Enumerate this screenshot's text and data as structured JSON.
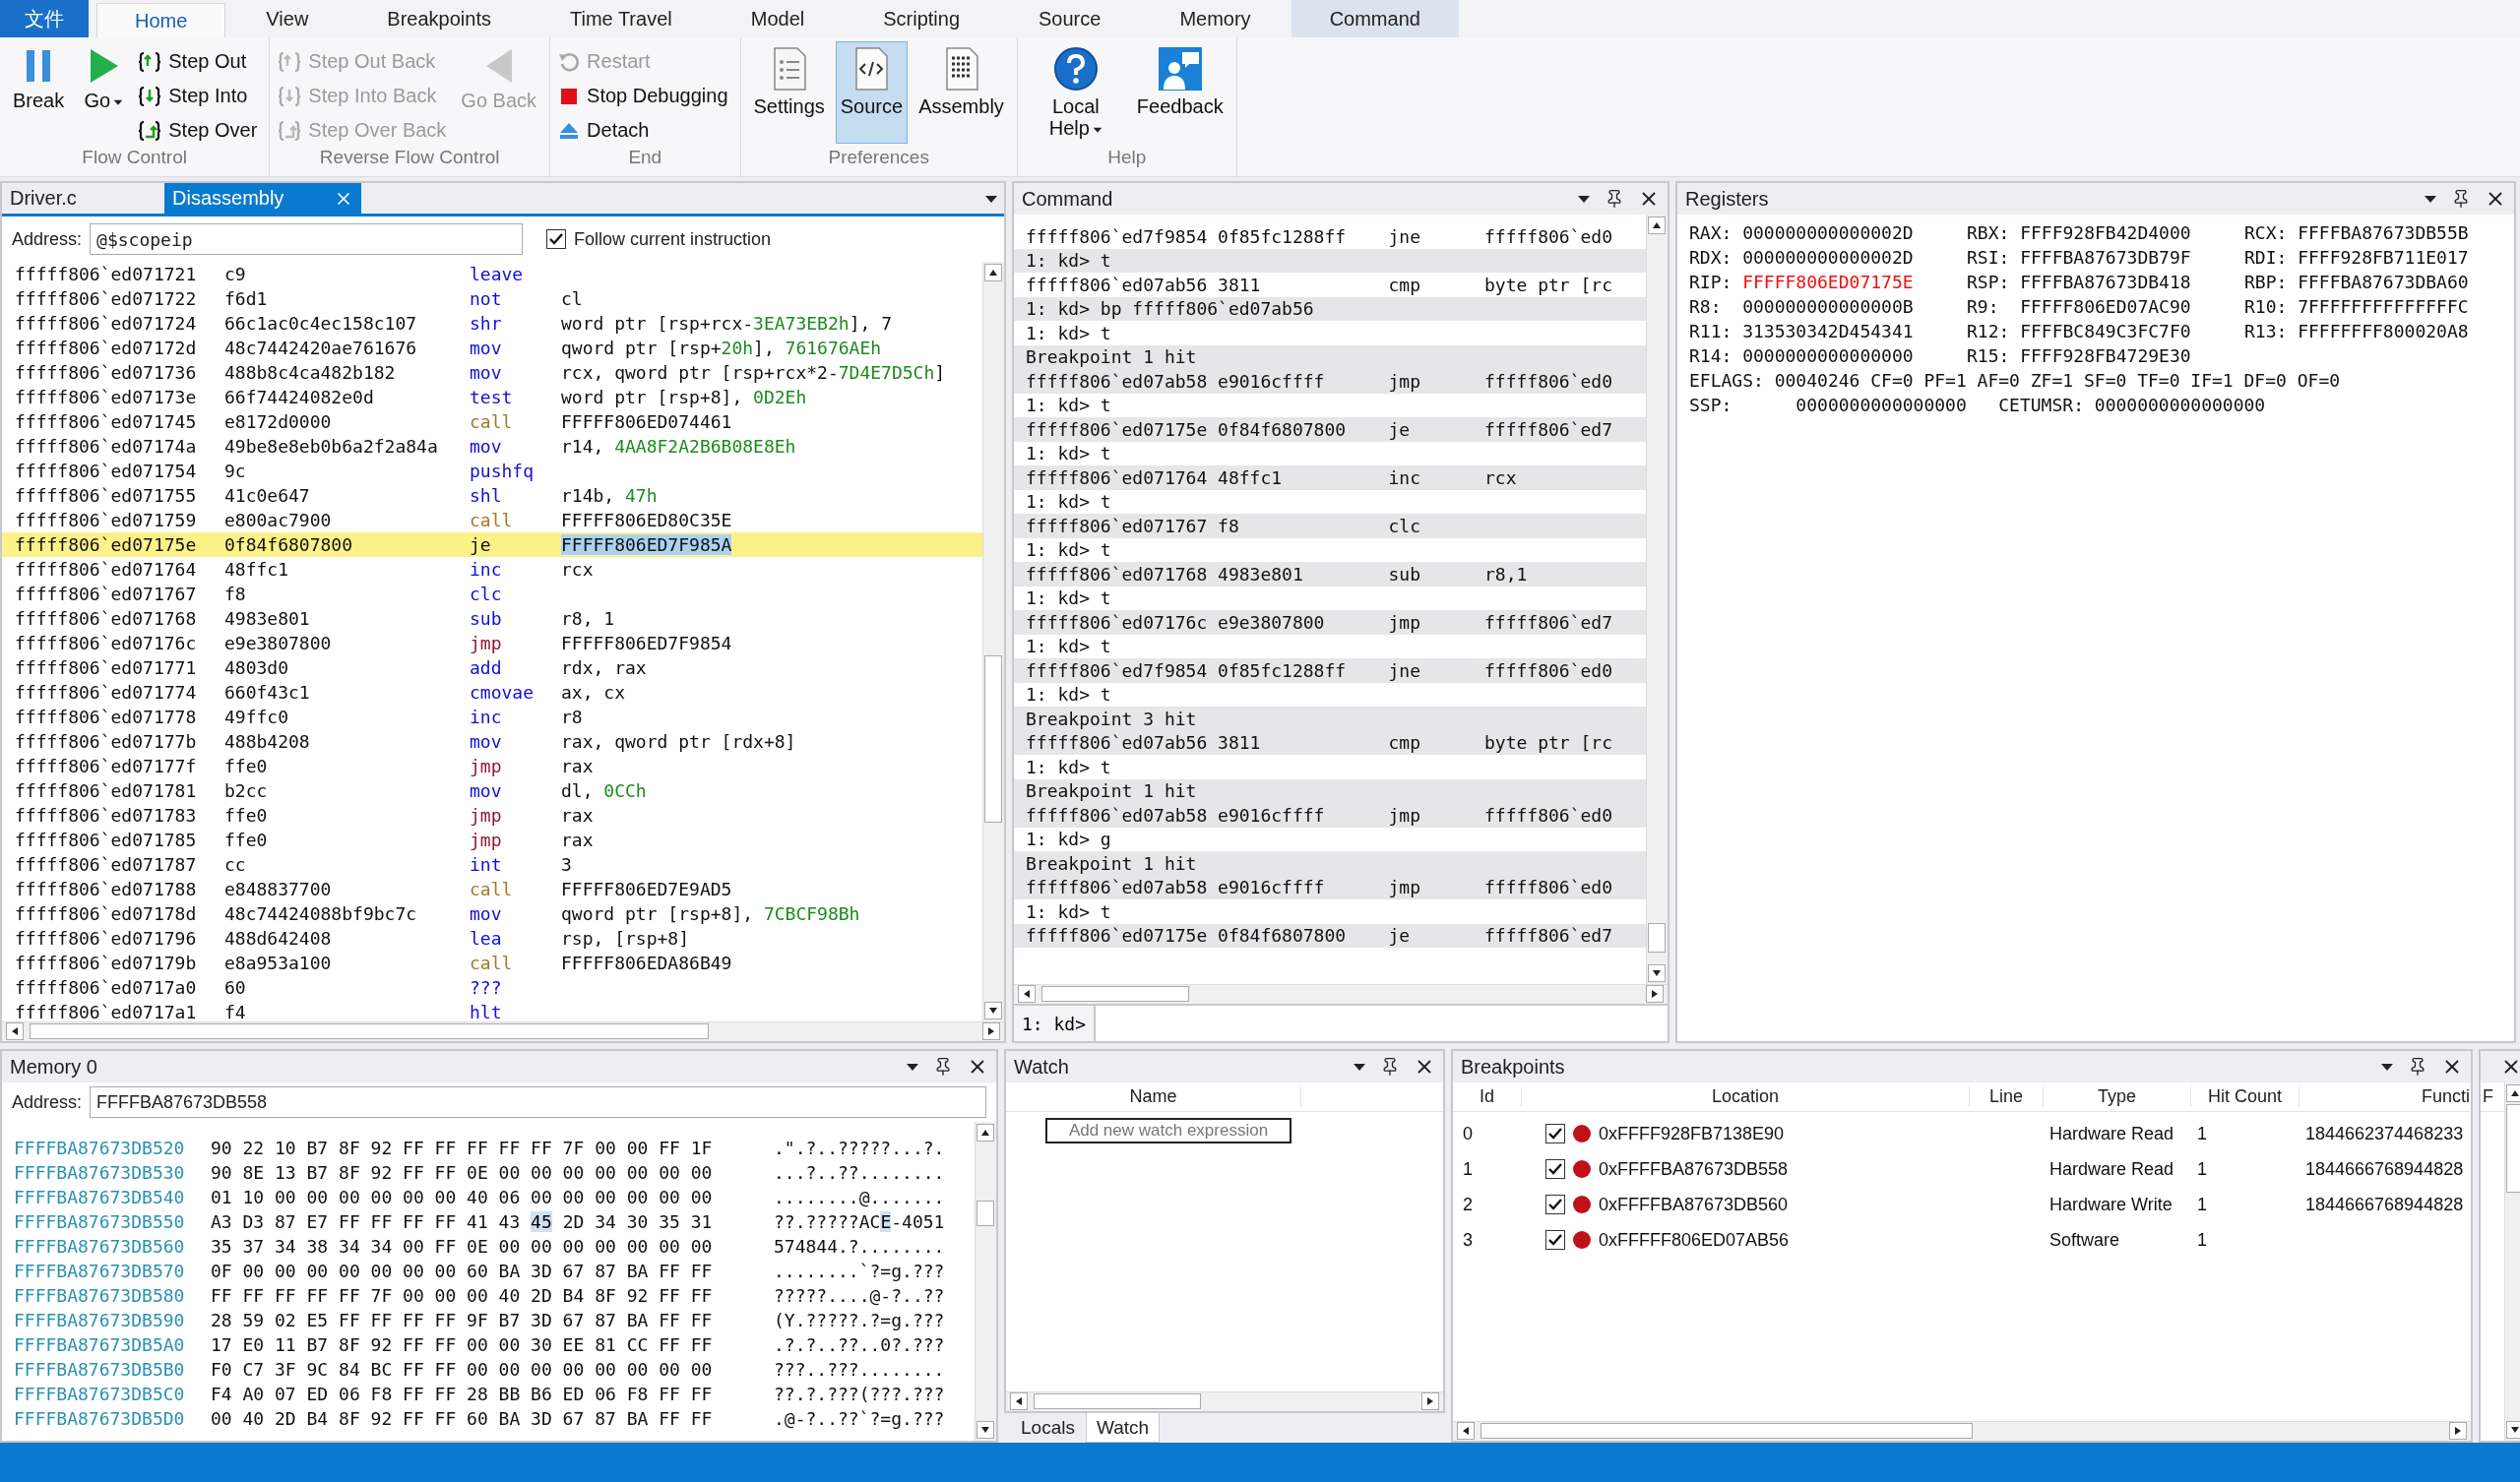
{
  "ribbon": {
    "tabs": [
      {
        "label": "文件",
        "kind": "file",
        "selected": false
      },
      {
        "label": "Home",
        "kind": "tab",
        "selected": true,
        "contextual": false
      },
      {
        "label": "View",
        "kind": "tab",
        "selected": false,
        "contextual": false
      },
      {
        "label": "Breakpoints",
        "kind": "tab",
        "selected": false,
        "contextual": false
      },
      {
        "label": "Time Travel",
        "kind": "tab",
        "selected": false,
        "contextual": false
      },
      {
        "label": "Model",
        "kind": "tab",
        "selected": false,
        "contextual": false
      },
      {
        "label": "Scripting",
        "kind": "tab",
        "selected": false,
        "contextual": false
      },
      {
        "label": "Source",
        "kind": "tab",
        "selected": false,
        "contextual": false
      },
      {
        "label": "Memory",
        "kind": "tab",
        "selected": false,
        "contextual": false
      },
      {
        "label": "Command",
        "kind": "tab",
        "selected": false,
        "contextual": true
      }
    ],
    "groups": [
      {
        "label": "Flow Control",
        "items": [
          {
            "kind": "large",
            "label": "Break",
            "disabled": false,
            "selected": false,
            "dropdown": false
          },
          {
            "kind": "large",
            "label": "Go",
            "disabled": false,
            "selected": false,
            "dropdown": true
          },
          {
            "kind": "small",
            "label": "Step Out",
            "disabled": false
          },
          {
            "kind": "small",
            "label": "Step Into",
            "disabled": false
          },
          {
            "kind": "small",
            "label": "Step Over",
            "disabled": false
          }
        ]
      },
      {
        "label": "Reverse Flow Control",
        "items": [
          {
            "kind": "small",
            "label": "Step Out Back",
            "disabled": true
          },
          {
            "kind": "small",
            "label": "Step Into Back",
            "disabled": true
          },
          {
            "kind": "small",
            "label": "Step Over Back",
            "disabled": true
          },
          {
            "kind": "large",
            "label": "Go Back",
            "disabled": true,
            "selected": false,
            "dropdown": false
          }
        ]
      },
      {
        "label": "End",
        "items": [
          {
            "kind": "small",
            "label": "Restart",
            "disabled": true
          },
          {
            "kind": "small",
            "label": "Stop Debugging",
            "disabled": false
          },
          {
            "kind": "small",
            "label": "Detach",
            "disabled": false
          }
        ]
      },
      {
        "label": "Preferences",
        "items": [
          {
            "kind": "large",
            "label": "Settings",
            "disabled": false,
            "selected": false,
            "dropdown": false
          },
          {
            "kind": "large",
            "label": "Source",
            "disabled": false,
            "selected": true,
            "dropdown": false
          },
          {
            "kind": "large",
            "label": "Assembly",
            "disabled": false,
            "selected": false,
            "dropdown": false
          }
        ]
      },
      {
        "label": "Help",
        "items": [
          {
            "kind": "large",
            "label": "Local Help",
            "disabled": false,
            "selected": false,
            "dropdown": true
          },
          {
            "kind": "large",
            "label": "Feedback",
            "disabled": false,
            "selected": false,
            "dropdown": false
          }
        ]
      }
    ]
  },
  "disassembly": {
    "tabs": [
      {
        "label": "Driver.c",
        "selected": false
      },
      {
        "label": "Disassembly",
        "selected": true
      }
    ],
    "address_label": "Address:",
    "address": "@$scopeip",
    "follow": {
      "label": "Follow current instruction",
      "checked": true
    },
    "rows": [
      {
        "address": "fffff806`ed071721",
        "bytes": "c9",
        "mnemonic": "leave",
        "color": "#1010d8",
        "current": false,
        "operands": []
      },
      {
        "address": "fffff806`ed071722",
        "bytes": "f6d1",
        "mnemonic": "not",
        "color": "#1010d8",
        "current": false,
        "operands": [
          {
            "text": "cl",
            "color": "#111111",
            "selected": false
          }
        ]
      },
      {
        "address": "fffff806`ed071724",
        "bytes": "66c1ac0c4ec158c107",
        "mnemonic": "shr",
        "color": "#1010d8",
        "current": false,
        "operands": [
          {
            "text": "word ptr [rsp+rcx-",
            "color": "#111111",
            "selected": false
          },
          {
            "text": "3EA73EB2h",
            "color": "#1c8a1c",
            "selected": false
          },
          {
            "text": "], 7",
            "color": "#111111",
            "selected": false
          }
        ]
      },
      {
        "address": "fffff806`ed07172d",
        "bytes": "48c7442420ae761676",
        "mnemonic": "mov",
        "color": "#1010d8",
        "current": false,
        "operands": [
          {
            "text": "qword ptr [rsp+",
            "color": "#111111",
            "selected": false
          },
          {
            "text": "20h",
            "color": "#1c8a1c",
            "selected": false
          },
          {
            "text": "], ",
            "color": "#111111",
            "selected": false
          },
          {
            "text": "761676AEh",
            "color": "#1c8a1c",
            "selected": false
          }
        ]
      },
      {
        "address": "fffff806`ed071736",
        "bytes": "488b8c4ca482b182",
        "mnemonic": "mov",
        "color": "#1010d8",
        "current": false,
        "operands": [
          {
            "text": "rcx, qword ptr [rsp+rcx*2-",
            "color": "#111111",
            "selected": false
          },
          {
            "text": "7D4E7D5Ch",
            "color": "#1c8a1c",
            "selected": false
          },
          {
            "text": "]",
            "color": "#111111",
            "selected": false
          }
        ]
      },
      {
        "address": "fffff806`ed07173e",
        "bytes": "66f74424082e0d",
        "mnemonic": "test",
        "color": "#1010d8",
        "current": false,
        "operands": [
          {
            "text": "word ptr [rsp+8], ",
            "color": "#111111",
            "selected": false
          },
          {
            "text": "0D2Eh",
            "color": "#1c8a1c",
            "selected": false
          }
        ]
      },
      {
        "address": "fffff806`ed071745",
        "bytes": "e8172d0000",
        "mnemonic": "call",
        "color": "#a07a28",
        "current": false,
        "operands": [
          {
            "text": "FFFFF806ED074461",
            "color": "#111111",
            "selected": false
          }
        ]
      },
      {
        "address": "fffff806`ed07174a",
        "bytes": "49be8e8eb0b6a2f2a84a",
        "mnemonic": "mov",
        "color": "#1010d8",
        "current": false,
        "operands": [
          {
            "text": "r14, ",
            "color": "#111111",
            "selected": false
          },
          {
            "text": "4AA8F2A2B6B08E8Eh",
            "color": "#1c8a1c",
            "selected": false
          }
        ]
      },
      {
        "address": "fffff806`ed071754",
        "bytes": "9c",
        "mnemonic": "pushfq",
        "color": "#1010d8",
        "current": false,
        "operands": []
      },
      {
        "address": "fffff806`ed071755",
        "bytes": "41c0e647",
        "mnemonic": "shl",
        "color": "#1010d8",
        "current": false,
        "operands": [
          {
            "text": "r14b, ",
            "color": "#111111",
            "selected": false
          },
          {
            "text": "47h",
            "color": "#1c8a1c",
            "selected": false
          }
        ]
      },
      {
        "address": "fffff806`ed071759",
        "bytes": "e800ac7900",
        "mnemonic": "call",
        "color": "#a07a28",
        "current": false,
        "operands": [
          {
            "text": "FFFFF806ED80C35E",
            "color": "#111111",
            "selected": false
          }
        ]
      },
      {
        "address": "fffff806`ed07175e",
        "bytes": "0f84f6807800",
        "mnemonic": "je",
        "color": "#111111",
        "current": true,
        "operands": [
          {
            "text": "FFFFF806ED7F985A",
            "color": "#111111",
            "selected": true
          }
        ]
      },
      {
        "address": "fffff806`ed071764",
        "bytes": "48ffc1",
        "mnemonic": "inc",
        "color": "#1010d8",
        "current": false,
        "operands": [
          {
            "text": "rcx",
            "color": "#111111",
            "selected": false
          }
        ]
      },
      {
        "address": "fffff806`ed071767",
        "bytes": "f8",
        "mnemonic": "clc",
        "color": "#1010d8",
        "current": false,
        "operands": []
      },
      {
        "address": "fffff806`ed071768",
        "bytes": "4983e801",
        "mnemonic": "sub",
        "color": "#1010d8",
        "current": false,
        "operands": [
          {
            "text": "r8, 1",
            "color": "#111111",
            "selected": false
          }
        ]
      },
      {
        "address": "fffff806`ed07176c",
        "bytes": "e9e3807800",
        "mnemonic": "jmp",
        "color": "#8c1838",
        "current": false,
        "operands": [
          {
            "text": "FFFFF806ED7F9854",
            "color": "#111111",
            "selected": false
          }
        ]
      },
      {
        "address": "fffff806`ed071771",
        "bytes": "4803d0",
        "mnemonic": "add",
        "color": "#1010d8",
        "current": false,
        "operands": [
          {
            "text": "rdx, rax",
            "color": "#111111",
            "selected": false
          }
        ]
      },
      {
        "address": "fffff806`ed071774",
        "bytes": "660f43c1",
        "mnemonic": "cmovae",
        "color": "#1010d8",
        "current": false,
        "operands": [
          {
            "text": "ax, cx",
            "color": "#111111",
            "selected": false
          }
        ]
      },
      {
        "address": "fffff806`ed071778",
        "bytes": "49ffc0",
        "mnemonic": "inc",
        "color": "#1010d8",
        "current": false,
        "operands": [
          {
            "text": "r8",
            "color": "#111111",
            "selected": false
          }
        ]
      },
      {
        "address": "fffff806`ed07177b",
        "bytes": "488b4208",
        "mnemonic": "mov",
        "color": "#1010d8",
        "current": false,
        "operands": [
          {
            "text": "rax, qword ptr [rdx+8]",
            "color": "#111111",
            "selected": false
          }
        ]
      },
      {
        "address": "fffff806`ed07177f",
        "bytes": "ffe0",
        "mnemonic": "jmp",
        "color": "#8c1838",
        "current": false,
        "operands": [
          {
            "text": "rax",
            "color": "#111111",
            "selected": false
          }
        ]
      },
      {
        "address": "fffff806`ed071781",
        "bytes": "b2cc",
        "mnemonic": "mov",
        "color": "#1010d8",
        "current": false,
        "operands": [
          {
            "text": "dl, ",
            "color": "#111111",
            "selected": false
          },
          {
            "text": "0CCh",
            "color": "#1c8a1c",
            "selected": false
          }
        ]
      },
      {
        "address": "fffff806`ed071783",
        "bytes": "ffe0",
        "mnemonic": "jmp",
        "color": "#8c1838",
        "current": false,
        "operands": [
          {
            "text": "rax",
            "color": "#111111",
            "selected": false
          }
        ]
      },
      {
        "address": "fffff806`ed071785",
        "bytes": "ffe0",
        "mnemonic": "jmp",
        "color": "#8c1838",
        "current": false,
        "operands": [
          {
            "text": "rax",
            "color": "#111111",
            "selected": false
          }
        ]
      },
      {
        "address": "fffff806`ed071787",
        "bytes": "cc",
        "mnemonic": "int",
        "color": "#1010d8",
        "current": false,
        "operands": [
          {
            "text": "3",
            "color": "#111111",
            "selected": false
          }
        ]
      },
      {
        "address": "fffff806`ed071788",
        "bytes": "e848837700",
        "mnemonic": "call",
        "color": "#a07a28",
        "current": false,
        "operands": [
          {
            "text": "FFFFF806ED7E9AD5",
            "color": "#111111",
            "selected": false
          }
        ]
      },
      {
        "address": "fffff806`ed07178d",
        "bytes": "48c74424088bf9bc7c",
        "mnemonic": "mov",
        "color": "#1010d8",
        "current": false,
        "operands": [
          {
            "text": "qword ptr [rsp+8], ",
            "color": "#111111",
            "selected": false
          },
          {
            "text": "7CBCF98Bh",
            "color": "#1c8a1c",
            "selected": false
          }
        ]
      },
      {
        "address": "fffff806`ed071796",
        "bytes": "488d642408",
        "mnemonic": "lea",
        "color": "#1010d8",
        "current": false,
        "operands": [
          {
            "text": "rsp, [rsp+8]",
            "color": "#111111",
            "selected": false
          }
        ]
      },
      {
        "address": "fffff806`ed07179b",
        "bytes": "e8a953a100",
        "mnemonic": "call",
        "color": "#a07a28",
        "current": false,
        "operands": [
          {
            "text": "FFFFF806EDA86B49",
            "color": "#111111",
            "selected": false
          }
        ]
      },
      {
        "address": "fffff806`ed0717a0",
        "bytes": "60",
        "mnemonic": "???",
        "color": "#1010d8",
        "current": false,
        "operands": []
      },
      {
        "address": "fffff806`ed0717a1",
        "bytes": "f4",
        "mnemonic": "hlt",
        "color": "#1010d8",
        "current": false,
        "operands": []
      }
    ]
  },
  "command": {
    "title": "Command",
    "prompt": "1: kd>",
    "lines": [
      {
        "kind": "instr",
        "text": "fffff806`ed7f9854 0f85fc1288ff",
        "mnemonic": "jne",
        "operands": "fffff806`ed0",
        "shaded": false
      },
      {
        "kind": "text",
        "text": "1: kd> t",
        "shaded": true
      },
      {
        "kind": "instr",
        "text": "fffff806`ed07ab56 3811",
        "mnemonic": "cmp",
        "operands": "byte ptr [rc",
        "shaded": false
      },
      {
        "kind": "text",
        "text": "1: kd> bp fffff806`ed07ab56",
        "shaded": true
      },
      {
        "kind": "text",
        "text": "1: kd> t",
        "shaded": false
      },
      {
        "kind": "text",
        "text": "Breakpoint 1 hit",
        "shaded": true
      },
      {
        "kind": "instr",
        "text": "fffff806`ed07ab58 e9016cffff",
        "mnemonic": "jmp",
        "operands": "fffff806`ed0",
        "shaded": true
      },
      {
        "kind": "text",
        "text": "1: kd> t",
        "shaded": false
      },
      {
        "kind": "instr",
        "text": "fffff806`ed07175e 0f84f6807800",
        "mnemonic": "je",
        "operands": "fffff806`ed7",
        "shaded": true
      },
      {
        "kind": "text",
        "text": "1: kd> t",
        "shaded": false
      },
      {
        "kind": "instr",
        "text": "fffff806`ed071764 48ffc1",
        "mnemonic": "inc",
        "operands": "rcx",
        "shaded": true
      },
      {
        "kind": "text",
        "text": "1: kd> t",
        "shaded": false
      },
      {
        "kind": "instr",
        "text": "fffff806`ed071767 f8",
        "mnemonic": "clc",
        "shaded": true
      },
      {
        "kind": "text",
        "text": "1: kd> t",
        "shaded": false
      },
      {
        "kind": "instr",
        "text": "fffff806`ed071768 4983e801",
        "mnemonic": "sub",
        "operands": "r8,1",
        "shaded": true
      },
      {
        "kind": "text",
        "text": "1: kd> t",
        "shaded": false
      },
      {
        "kind": "instr",
        "text": "fffff806`ed07176c e9e3807800",
        "mnemonic": "jmp",
        "operands": "fffff806`ed7",
        "shaded": true
      },
      {
        "kind": "text",
        "text": "1: kd> t",
        "shaded": false
      },
      {
        "kind": "instr",
        "text": "fffff806`ed7f9854 0f85fc1288ff",
        "mnemonic": "jne",
        "operands": "fffff806`ed0",
        "shaded": true
      },
      {
        "kind": "text",
        "text": "1: kd> t",
        "shaded": false
      },
      {
        "kind": "text",
        "text": "Breakpoint 3 hit",
        "shaded": true
      },
      {
        "kind": "instr",
        "text": "fffff806`ed07ab56 3811",
        "mnemonic": "cmp",
        "operands": "byte ptr [rc",
        "shaded": true
      },
      {
        "kind": "text",
        "text": "1: kd> t",
        "shaded": false
      },
      {
        "kind": "text",
        "text": "Breakpoint 1 hit",
        "shaded": true
      },
      {
        "kind": "instr",
        "text": "fffff806`ed07ab58 e9016cffff",
        "mnemonic": "jmp",
        "operands": "fffff806`ed0",
        "shaded": true
      },
      {
        "kind": "text",
        "text": "1: kd> g",
        "shaded": false
      },
      {
        "kind": "text",
        "text": "Breakpoint 1 hit",
        "shaded": true
      },
      {
        "kind": "instr",
        "text": "fffff806`ed07ab58 e9016cffff",
        "mnemonic": "jmp",
        "operands": "fffff806`ed0",
        "shaded": true
      },
      {
        "kind": "text",
        "text": "1: kd> t",
        "shaded": false
      },
      {
        "kind": "instr",
        "text": "fffff806`ed07175e 0f84f6807800",
        "mnemonic": "je",
        "operands": "fffff806`ed7",
        "shaded": true
      }
    ]
  },
  "registers": {
    "title": "Registers",
    "items": [
      {
        "name": "RAX:",
        "value": "000000000000002D",
        "changed": false
      },
      {
        "name": "RBX:",
        "value": "FFFF928FB42D4000",
        "changed": false
      },
      {
        "name": "RCX:",
        "value": "FFFFBA87673DB55B",
        "changed": false
      },
      {
        "name": "RDX:",
        "value": "000000000000002D",
        "changed": false
      },
      {
        "name": "RSI:",
        "value": "FFFFBA87673DB79F",
        "changed": false
      },
      {
        "name": "RDI:",
        "value": "FFFF928FB711E017",
        "changed": false
      },
      {
        "name": "RIP:",
        "value": "FFFFF806ED07175E",
        "changed": true
      },
      {
        "name": "RSP:",
        "value": "FFFFBA87673DB418",
        "changed": false
      },
      {
        "name": "RBP:",
        "value": "FFFFBA87673DBA60",
        "changed": false
      },
      {
        "name": "R8:",
        "value": "000000000000000B",
        "changed": false
      },
      {
        "name": "R9:",
        "value": "FFFFF806ED07AC90",
        "changed": false
      },
      {
        "name": "R10:",
        "value": "7FFFFFFFFFFFFFFC",
        "changed": false
      },
      {
        "name": "R11:",
        "value": "313530342D454341",
        "changed": false
      },
      {
        "name": "R12:",
        "value": "FFFFBC849C3FC7F0",
        "changed": false
      },
      {
        "name": "R13:",
        "value": "FFFFFFFF800020A8",
        "changed": false
      },
      {
        "name": "R14:",
        "value": "0000000000000000",
        "changed": false
      },
      {
        "name": "R15:",
        "value": "FFFF928FB4729E30",
        "changed": false
      }
    ],
    "extra_lines": [
      "EFLAGS: 00040246 CF=0 PF=1 AF=0 ZF=1 SF=0 TF=0 IF=1 DF=0 OF=0",
      "SSP:      0000000000000000   CETUMSR: 0000000000000000"
    ]
  },
  "memory": {
    "title": "Memory 0",
    "address_label": "Address:",
    "address": "FFFFBA87673DB558",
    "rows": [
      {
        "address": "FFFFBA87673DB520",
        "bytes": "90 22 10 B7 8F 92 FF FF FF FF FF 7F 00 00 FF 1F",
        "ascii": ".\".?..?????...?."
      },
      {
        "address": "FFFFBA87673DB530",
        "bytes": "90 8E 13 B7 8F 92 FF FF 0E 00 00 00 00 00 00 00",
        "ascii": "...?..??........"
      },
      {
        "address": "FFFFBA87673DB540",
        "bytes": "01 10 00 00 00 00 00 00 40 06 00 00 00 00 00 00",
        "ascii": "........@......."
      },
      {
        "address": "FFFFBA87673DB550",
        "bytes": "A3 D3 87 E7 FF FF FF FF 41 43",
        "cursor_byte": "45",
        "bytes_after": "2D 34 30 35 31",
        "ascii": "??.?????AC",
        "cursor_char": "E",
        "ascii_after": "-4051"
      },
      {
        "address": "FFFFBA87673DB560",
        "bytes": "35 37 34 38 34 34 00 FF 0E 00 00 00 00 00 00 00",
        "ascii": "574844.?........"
      },
      {
        "address": "FFFFBA87673DB570",
        "bytes": "0F 00 00 00 00 00 00 00 60 BA 3D 67 87 BA FF FF",
        "ascii": "........`?=g.???"
      },
      {
        "address": "FFFFBA87673DB580",
        "bytes": "FF FF FF FF FF 7F 00 00 00 40 2D B4 8F 92 FF FF",
        "ascii": "?????....@-?..??"
      },
      {
        "address": "FFFFBA87673DB590",
        "bytes": "28 59 02 E5 FF FF FF FF 9F B7 3D 67 87 BA FF FF",
        "ascii": "(Y.?????.?=g.???"
      },
      {
        "address": "FFFFBA87673DB5A0",
        "bytes": "17 E0 11 B7 8F 92 FF FF 00 00 30 EE 81 CC FF FF",
        "ascii": ".?.?..??..0?.???"
      },
      {
        "address": "FFFFBA87673DB5B0",
        "bytes": "F0 C7 3F 9C 84 BC FF FF 00 00 00 00 00 00 00 00",
        "ascii": "???..???........"
      },
      {
        "address": "FFFFBA87673DB5C0",
        "bytes": "F4 A0 07 ED 06 F8 FF FF 28 BB B6 ED 06 F8 FF FF",
        "ascii": "??.?.???(???.???"
      },
      {
        "address": "FFFFBA87673DB5D0",
        "bytes": "00 40 2D B4 8F 92 FF FF 60 BA 3D 67 87 BA FF FF",
        "ascii": ".@-?..??`?=g.???"
      }
    ]
  },
  "watch": {
    "title": "Watch",
    "column": "Name",
    "placeholder": "Add new watch expression",
    "tabs": [
      {
        "label": "Locals",
        "selected": false
      },
      {
        "label": "Watch",
        "selected": true
      }
    ]
  },
  "breakpoints": {
    "title": "Breakpoints",
    "columns": [
      "Id",
      "Location",
      "Line",
      "Type",
      "Hit Count",
      "Functi"
    ],
    "rows": [
      {
        "id": "0",
        "enabled": true,
        "location": "0xFFFF928FB7138E90",
        "type": "Hardware Read",
        "hit_count": "1",
        "function": "1844662374468233"
      },
      {
        "id": "1",
        "enabled": true,
        "location": "0xFFFFBA87673DB558",
        "type": "Hardware Read",
        "hit_count": "1",
        "function": "1844666768944828"
      },
      {
        "id": "2",
        "enabled": true,
        "location": "0xFFFFBA87673DB560",
        "type": "Hardware Write",
        "hit_count": "1",
        "function": "1844666768944828"
      },
      {
        "id": "3",
        "enabled": true,
        "location": "0xFFFFF806ED07AB56",
        "type": "Software",
        "hit_count": "1"
      }
    ]
  },
  "side_panel": {
    "column": "F"
  }
}
